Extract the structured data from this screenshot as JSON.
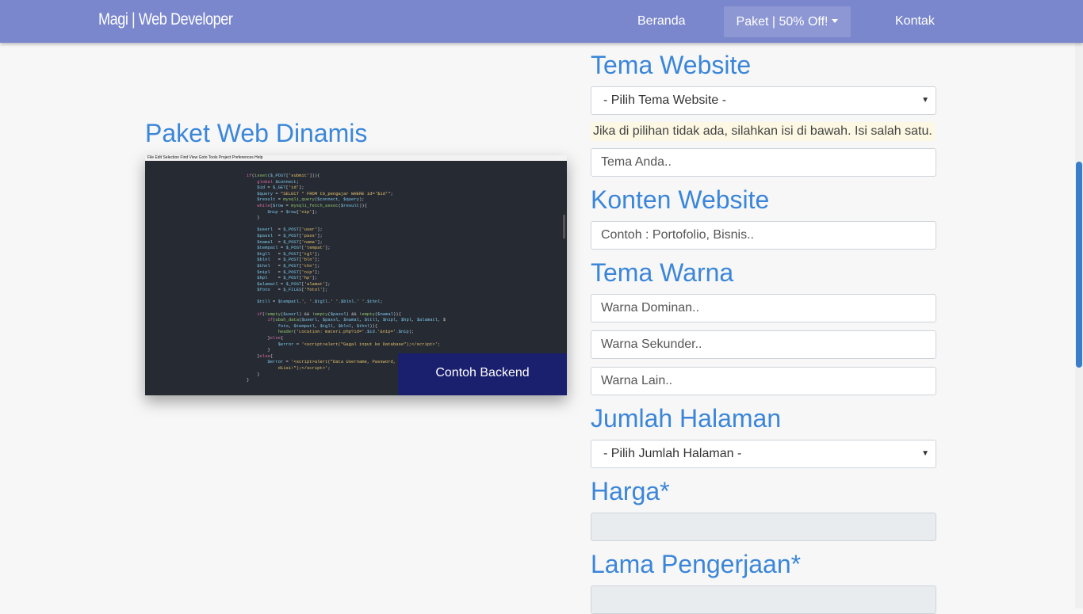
{
  "navbar": {
    "brand": "Magi | Web Developer",
    "links": [
      {
        "label": "Beranda"
      },
      {
        "label": "Paket | 50% Off!"
      },
      {
        "label": "Kontak"
      }
    ]
  },
  "left": {
    "title": "Paket Web Dinamis",
    "caption": "Contoh Backend",
    "editor_menu": "File  Edit  Selection  Find  View  Goto  Tools  Project  Preferences  Help"
  },
  "form": {
    "tema_website": {
      "label": "Tema Website",
      "select_value": "- Pilih Tema Website -",
      "hint": "Jika di pilihan tidak ada, silahkan isi di bawah. Isi salah satu.",
      "input_placeholder": "Tema Anda.."
    },
    "konten_website": {
      "label": "Konten Website",
      "input_placeholder": "Contoh : Portofolio, Bisnis.."
    },
    "tema_warna": {
      "label": "Tema Warna",
      "dominan_placeholder": "Warna Dominan..",
      "sekunder_placeholder": "Warna Sekunder..",
      "lain_placeholder": "Warna Lain.."
    },
    "jumlah_halaman": {
      "label": "Jumlah Halaman",
      "select_value": "- Pilih Jumlah Halaman -"
    },
    "harga": {
      "label": "Harga*",
      "value": ""
    },
    "lama_pengerjaan": {
      "label": "Lama Pengerjaan*",
      "value": ""
    }
  },
  "colors": {
    "navbar": "#7b87cc",
    "accent_text": "#3b86d8",
    "caption_bg": "#1a1f6e"
  }
}
